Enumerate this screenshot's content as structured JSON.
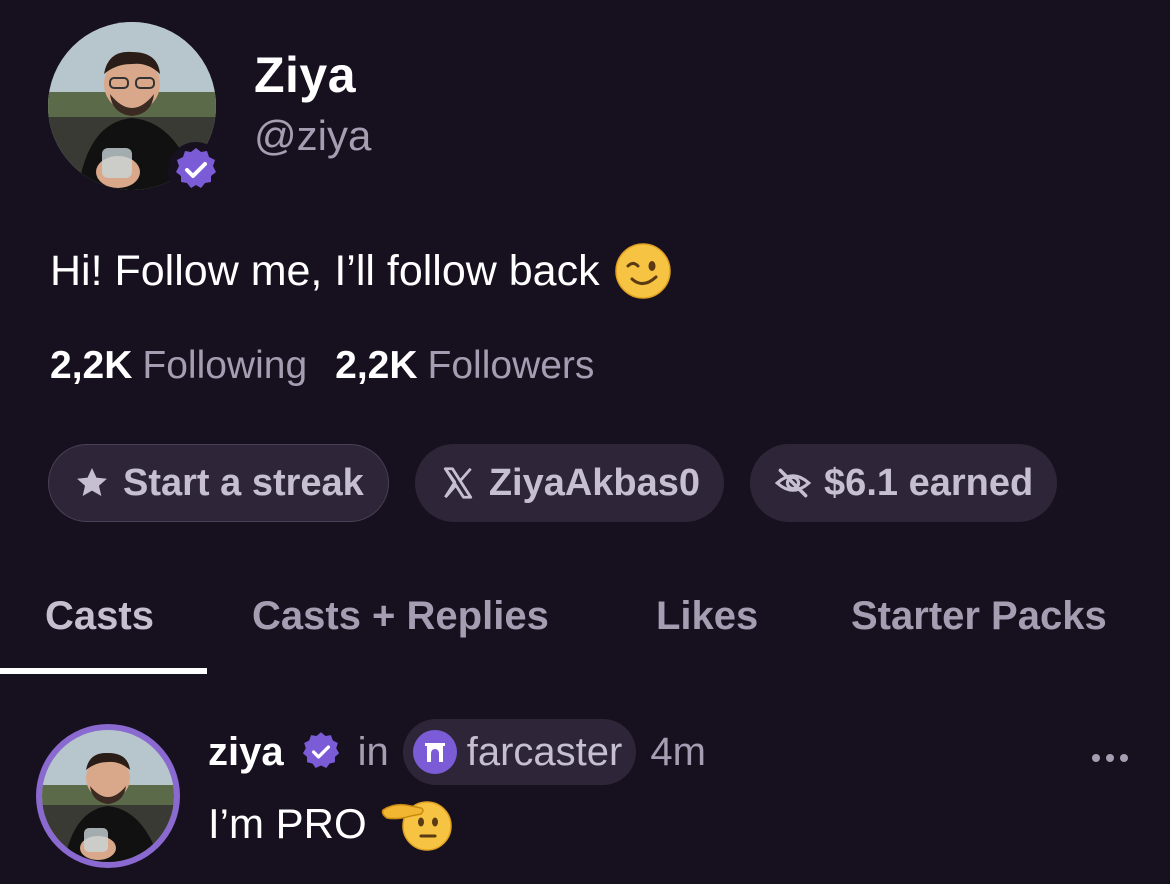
{
  "profile": {
    "display_name": "Ziya",
    "handle": "@ziya",
    "bio": "Hi! Follow me, I’ll follow back",
    "following_count": "2,2K",
    "following_label": "Following",
    "followers_count": "2,2K",
    "followers_label": "Followers"
  },
  "chips": {
    "streak": "Start a streak",
    "x_account": "ZiyaAkbas0",
    "earned": "$6.1 earned"
  },
  "tabs": [
    {
      "label": "Casts",
      "active": true
    },
    {
      "label": "Casts + Replies",
      "active": false
    },
    {
      "label": "Likes",
      "active": false
    },
    {
      "label": "Starter Packs",
      "active": false
    }
  ],
  "cast": {
    "author": "ziya",
    "in_label": "in",
    "channel": "farcaster",
    "time": "4m",
    "text": "I’m PRO"
  },
  "colors": {
    "background": "#17111f",
    "chip_bg": "#2e2638",
    "muted_text": "#a59db1",
    "verified_purple": "#7c5cd6"
  },
  "icons": {
    "verified": "verified-badge-icon",
    "star": "star-icon",
    "x": "x-logo-icon",
    "eye_off": "eye-off-icon",
    "channel": "farcaster-arch-icon",
    "more": "more-dots-icon"
  }
}
